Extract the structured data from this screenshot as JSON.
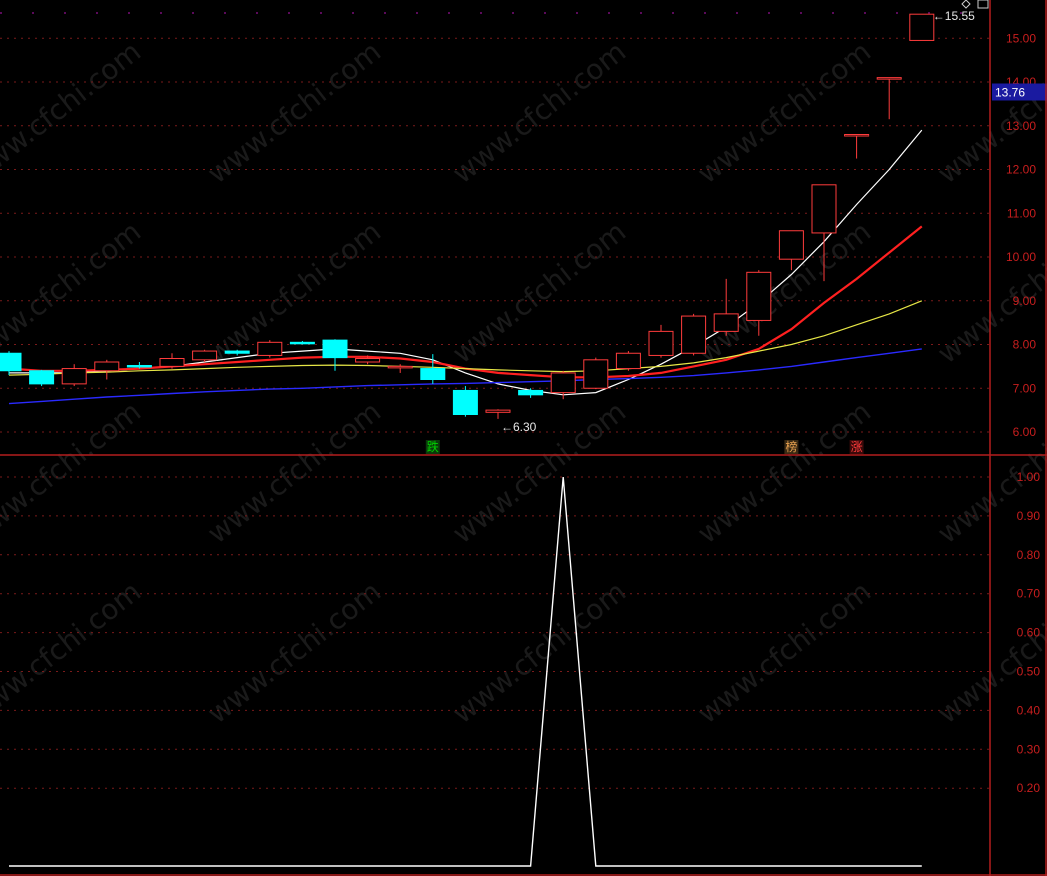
{
  "chart_data": [
    {
      "type": "candlestick",
      "title": "",
      "ylim": [
        5.6,
        15.9
      ],
      "y_ticks": [
        "15.00",
        "14.00",
        "13.00",
        "12.00",
        "11.00",
        "10.00",
        "9.00",
        "8.00",
        "7.00",
        "6.00"
      ],
      "current_price": "13.76",
      "high_label": "15.55",
      "low_label": "6.30",
      "colors": {
        "up": "#ff3c3c",
        "down": "#00ffff",
        "ma1": "#ffffff",
        "ma2": "#ff2020",
        "ma3": "#e6e646",
        "ma4": "#2a2aff",
        "grid": "#7a1a1a"
      },
      "candles": [
        {
          "o": 7.8,
          "h": 7.85,
          "l": 7.3,
          "c": 7.4
        },
        {
          "o": 7.4,
          "h": 7.42,
          "l": 7.05,
          "c": 7.1
        },
        {
          "o": 7.1,
          "h": 7.55,
          "l": 7.05,
          "c": 7.45
        },
        {
          "o": 7.4,
          "h": 7.65,
          "l": 7.2,
          "c": 7.6
        },
        {
          "o": 7.52,
          "h": 7.6,
          "l": 7.45,
          "c": 7.5
        },
        {
          "o": 7.5,
          "h": 7.8,
          "l": 7.45,
          "c": 7.68
        },
        {
          "o": 7.65,
          "h": 7.88,
          "l": 7.6,
          "c": 7.85
        },
        {
          "o": 7.85,
          "h": 7.88,
          "l": 7.75,
          "c": 7.8
        },
        {
          "o": 7.75,
          "h": 8.1,
          "l": 7.7,
          "c": 8.05
        },
        {
          "o": 8.05,
          "h": 8.08,
          "l": 8.0,
          "c": 8.02
        },
        {
          "o": 8.1,
          "h": 8.12,
          "l": 7.4,
          "c": 7.7
        },
        {
          "o": 7.6,
          "h": 7.75,
          "l": 7.55,
          "c": 7.68
        },
        {
          "o": 7.5,
          "h": 7.55,
          "l": 7.35,
          "c": 7.5
        },
        {
          "o": 7.45,
          "h": 7.78,
          "l": 7.1,
          "c": 7.2
        },
        {
          "o": 6.95,
          "h": 7.05,
          "l": 6.35,
          "c": 6.4
        },
        {
          "o": 6.45,
          "h": 6.52,
          "l": 6.3,
          "c": 6.5
        },
        {
          "o": 6.95,
          "h": 7.0,
          "l": 6.78,
          "c": 6.85
        },
        {
          "o": 6.9,
          "h": 7.4,
          "l": 6.75,
          "c": 7.35
        },
        {
          "o": 7.0,
          "h": 7.7,
          "l": 6.98,
          "c": 7.65
        },
        {
          "o": 7.45,
          "h": 7.85,
          "l": 7.4,
          "c": 7.8
        },
        {
          "o": 7.75,
          "h": 8.45,
          "l": 7.7,
          "c": 8.3
        },
        {
          "o": 7.8,
          "h": 8.7,
          "l": 7.75,
          "c": 8.65
        },
        {
          "o": 8.3,
          "h": 9.5,
          "l": 8.2,
          "c": 8.7
        },
        {
          "o": 8.55,
          "h": 9.7,
          "l": 8.2,
          "c": 9.65
        },
        {
          "o": 9.95,
          "h": 10.6,
          "l": 9.7,
          "c": 10.6
        },
        {
          "o": 10.55,
          "h": 11.65,
          "l": 9.45,
          "c": 11.65
        },
        {
          "o": 12.8,
          "h": 12.8,
          "l": 12.25,
          "c": 12.8
        },
        {
          "o": 14.1,
          "h": 14.1,
          "l": 13.15,
          "c": 14.1
        },
        {
          "o": 14.95,
          "h": 15.55,
          "l": 14.95,
          "c": 15.55
        }
      ],
      "ma_series": [
        {
          "values": [
            7.35,
            7.35,
            7.35,
            7.4,
            7.45,
            7.5,
            7.6,
            7.7,
            7.8,
            7.85,
            7.9,
            7.85,
            7.8,
            7.65,
            7.35,
            7.1,
            6.95,
            6.85,
            6.9,
            7.2,
            7.55,
            7.95,
            8.4,
            8.95,
            9.6,
            10.35,
            11.2,
            12.0,
            12.9
          ]
        },
        {
          "values": [
            7.45,
            7.4,
            7.4,
            7.42,
            7.45,
            7.5,
            7.55,
            7.6,
            7.65,
            7.7,
            7.72,
            7.72,
            7.68,
            7.6,
            7.45,
            7.35,
            7.3,
            7.25,
            7.25,
            7.28,
            7.35,
            7.5,
            7.65,
            7.9,
            8.35,
            8.95,
            9.5,
            10.1,
            10.7
          ]
        },
        {
          "values": [
            7.3,
            7.32,
            7.35,
            7.37,
            7.4,
            7.42,
            7.45,
            7.48,
            7.5,
            7.52,
            7.53,
            7.52,
            7.5,
            7.48,
            7.45,
            7.42,
            7.4,
            7.38,
            7.4,
            7.45,
            7.5,
            7.58,
            7.7,
            7.85,
            8.0,
            8.2,
            8.45,
            8.7,
            9.0
          ]
        },
        {
          "values": [
            6.65,
            6.7,
            6.75,
            6.8,
            6.84,
            6.88,
            6.92,
            6.95,
            6.98,
            7.0,
            7.03,
            7.06,
            7.08,
            7.1,
            7.11,
            7.13,
            7.15,
            7.17,
            7.2,
            7.22,
            7.25,
            7.29,
            7.35,
            7.42,
            7.5,
            7.6,
            7.7,
            7.8,
            7.9
          ]
        }
      ],
      "markers": [
        {
          "bar": 13,
          "text": "跌",
          "color": "#00d200",
          "bg": "#0a3a0a"
        },
        {
          "bar": 24,
          "text": "榜",
          "color": "#e6a050",
          "bg": "#3a2a14"
        },
        {
          "bar": 26,
          "text": "涨",
          "color": "#ff3c3c",
          "bg": "#3a0a0a"
        }
      ]
    },
    {
      "type": "line",
      "ylim": [
        0,
        1.05
      ],
      "y_ticks": [
        "1.00",
        "0.90",
        "0.80",
        "0.70",
        "0.60",
        "0.50",
        "0.40",
        "0.30",
        "0.20"
      ],
      "series": [
        {
          "values": [
            0,
            0,
            0,
            0,
            0,
            0,
            0,
            0,
            0,
            0,
            0,
            0,
            0,
            0,
            0,
            0,
            0,
            1,
            0,
            0,
            0,
            0,
            0,
            0,
            0,
            0,
            0,
            0,
            0
          ],
          "color": "#ffffff"
        }
      ]
    }
  ],
  "watermark": "www.cfchi.com"
}
